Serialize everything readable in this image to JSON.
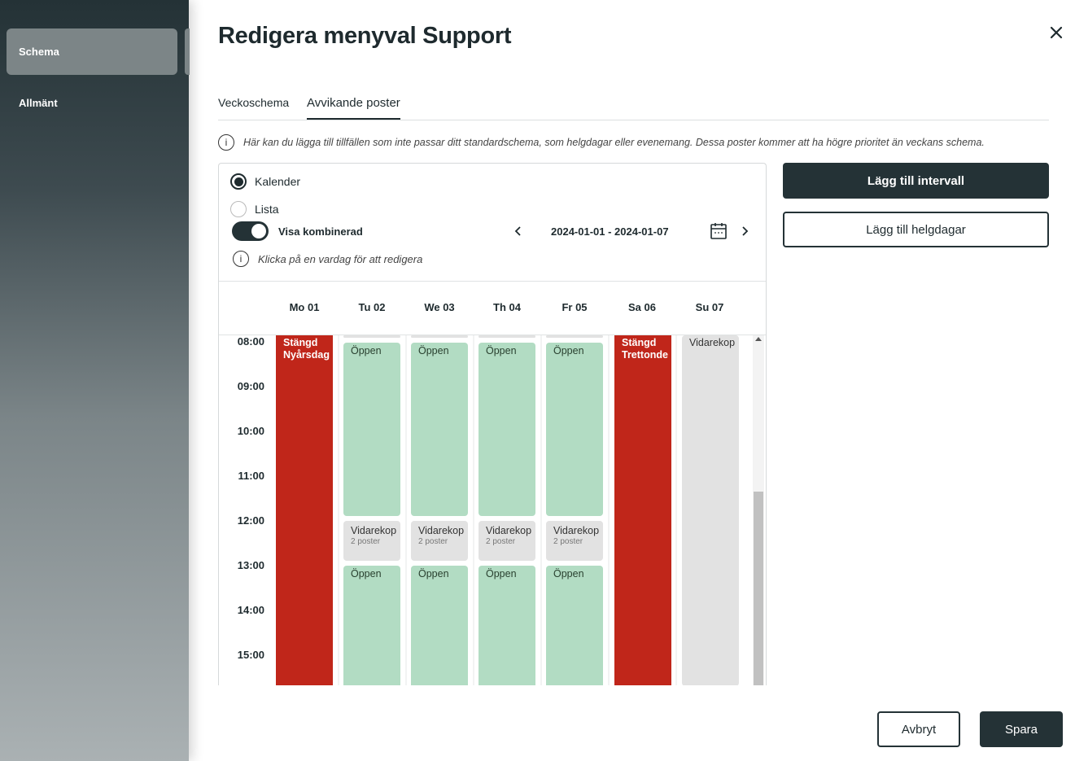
{
  "sidebar": {
    "items": [
      {
        "label": "Schema",
        "active": true
      },
      {
        "label": "Allmänt",
        "active": false
      }
    ]
  },
  "dialog": {
    "title": "Redigera menyval Support",
    "close_icon": "close-icon"
  },
  "tabs": [
    {
      "label": "Veckoschema",
      "active": false
    },
    {
      "label": "Avvikande poster",
      "active": true
    }
  ],
  "info": {
    "text": "Här kan du lägga till tillfällen som inte passar ditt standardschema, som helgdagar eller evenemang. Dessa poster kommer att ha högre prioritet än veckans schema."
  },
  "view": {
    "options": [
      {
        "label": "Kalender",
        "selected": true
      },
      {
        "label": "Lista",
        "selected": false
      }
    ],
    "toggle_label": "Visa kombinerad",
    "toggle_on": true,
    "hint": "Klicka på en vardag för att redigera",
    "date_range": "2024-01-01 - 2024-01-07"
  },
  "calendar": {
    "days": [
      "Mo 01",
      "Tu 02",
      "We 03",
      "Th 04",
      "Fr 05",
      "Sa 06",
      "Su 07"
    ],
    "hours": [
      "08:00",
      "09:00",
      "10:00",
      "11:00",
      "12:00",
      "13:00",
      "14:00",
      "15:00"
    ],
    "events": {
      "closed_mo_title": "Stängd",
      "closed_mo_sub": "Nyårsdag",
      "closed_sa_title": "Stängd",
      "closed_sa_sub": "Trettonde",
      "open_label": "Öppen",
      "grey_label": "Vidarekop",
      "grey_sub": "2 poster",
      "su_label": "Vidarekop"
    },
    "colors": {
      "closed": "#c0261a",
      "open": "#b2dcc3",
      "forward": "#e2e2e2"
    }
  },
  "actions": {
    "add_interval": "Lägg till intervall",
    "add_holidays": "Lägg till helgdagar"
  },
  "footer": {
    "cancel": "Avbryt",
    "save": "Spara"
  }
}
